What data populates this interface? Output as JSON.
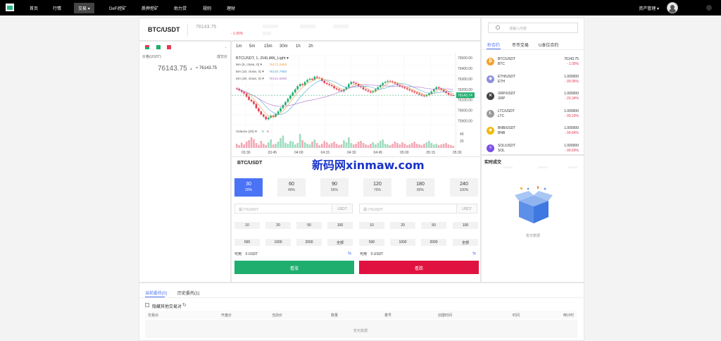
{
  "nav": {
    "items": [
      "首页",
      "行情",
      "交易",
      "DeFi挖矿",
      "质押挖矿",
      "助力贷",
      "规则",
      "理财"
    ],
    "active": "交易",
    "asset_menu": "资产管理"
  },
  "header": {
    "pair": "BTC/USDT",
    "price": "76143.75",
    "change": "- 1.00%"
  },
  "orderbook": {
    "col_price": "价格(USDT)",
    "col_volume": "成交价",
    "last_price": "76143.75",
    "last_sub": "76143.75"
  },
  "chart_toolbar": {
    "timeframes": [
      "1m",
      "5m",
      "15m",
      "30m",
      "1h",
      "2h"
    ]
  },
  "chart_data": {
    "type": "candlestick",
    "title": "BTCUSDT, 1, ZHILIAN_Light",
    "indicators": [
      {
        "name": "MA (5, close, 0)",
        "value": "76171.2900",
        "color": "#e8a23c"
      },
      {
        "name": "MA (10, close, 0)",
        "value": "76140.7950",
        "color": "#4aa3d8"
      },
      {
        "name": "MA (30, close, 0)",
        "value": "76161.5690",
        "color": "#b071c7"
      }
    ],
    "y_ticks": [
      "76500.00",
      "76400.00",
      "76300.00",
      "76200.00",
      "76143.74",
      "76100.00",
      "76000.00",
      "75900.00"
    ],
    "y_range": [
      75850,
      76520
    ],
    "current_price": 76143.74,
    "x_ticks": [
      "03:30",
      "03:45",
      "04:00",
      "04:15",
      "04:30",
      "04:45",
      "05:00",
      "05:15",
      "05:30"
    ],
    "volume_label": "Volume (20)",
    "volume_a": "0",
    "volume_b": "6",
    "volume_ticks": [
      "40",
      "20"
    ],
    "closes": [
      76205,
      76190,
      76175,
      76160,
      76130,
      76100,
      76085,
      76060,
      76020,
      75990,
      75960,
      75940,
      75915,
      75930,
      75950,
      75940,
      75965,
      75990,
      76020,
      76050,
      76080,
      76110,
      76140,
      76170,
      76200,
      76230,
      76250,
      76240,
      76270,
      76290,
      76300,
      76290,
      76320,
      76310,
      76305,
      76280,
      76260,
      76250,
      76240,
      76230,
      76210,
      76200,
      76190,
      76180,
      76200,
      76220,
      76250,
      76270,
      76260,
      76250,
      76230,
      76220,
      76200,
      76190,
      76180,
      76170,
      76180,
      76200,
      76220,
      76240,
      76260,
      76270,
      76280,
      76275,
      76265,
      76255,
      76240,
      76230,
      76220,
      76210,
      76200,
      76190,
      76180,
      76170,
      76160,
      76150,
      76140,
      76135,
      76145,
      76160,
      76180,
      76200,
      76220,
      76210,
      76195,
      76180,
      76165,
      76150,
      76145,
      76143
    ],
    "volumes": [
      12,
      8,
      15,
      10,
      18,
      22,
      30,
      25,
      14,
      9,
      20,
      12,
      8,
      16,
      24,
      10,
      12,
      18,
      28,
      35,
      15,
      12,
      20,
      18,
      10,
      14,
      40,
      22,
      16,
      12,
      10,
      18,
      24,
      14,
      8,
      12,
      20,
      16,
      10,
      14,
      18,
      12,
      8,
      10,
      22,
      16,
      30,
      14,
      10,
      12,
      18,
      20,
      14,
      10,
      8,
      12,
      16,
      10,
      14,
      20,
      24,
      12,
      10,
      8,
      12,
      18,
      14,
      10,
      16,
      12,
      8,
      10,
      14,
      18,
      12,
      10,
      8,
      12,
      16,
      20,
      14,
      10,
      12,
      8,
      10,
      12,
      14,
      10,
      8,
      6
    ]
  },
  "trade": {
    "title": "BTC/USDT",
    "periods": [
      {
        "sec": "30",
        "pct": "20%"
      },
      {
        "sec": "60",
        "pct": "40%"
      },
      {
        "sec": "90",
        "pct": "55%"
      },
      {
        "sec": "120",
        "pct": "70%"
      },
      {
        "sec": "180",
        "pct": "80%"
      },
      {
        "sec": "240",
        "pct": "100%"
      }
    ],
    "amount_placeholder": "最少%USDT",
    "unit": "USDT",
    "quick_left": [
      "10",
      "20",
      "50",
      "100",
      "500",
      "1000",
      "2000",
      "全部"
    ],
    "quick_right": [
      "10",
      "20",
      "50",
      "100",
      "500",
      "1000",
      "2000",
      "全部"
    ],
    "avail_label": "可用",
    "avail_value": "0 USDT",
    "buy_label": "看涨",
    "sell_label": "看跌",
    "buy_color": "#1fae6e",
    "sell_color": "#e0123f"
  },
  "markets": {
    "search_placeholder": "请输入内容",
    "tabs": [
      "秒合约",
      "币币交易",
      "U本位合约"
    ],
    "rows": [
      {
        "pair": "BTC/USDT",
        "sym": "BTC",
        "price": "76143.75",
        "change": "- 1.00%",
        "color": "#f2a22c",
        "glyph": "₿"
      },
      {
        "pair": "ETH/USDT",
        "sym": "ETH",
        "price": "1.000000",
        "change": "- 99.95%",
        "color": "#8c8fe0",
        "glyph": "◆"
      },
      {
        "pair": "XRP/USDT",
        "sym": "XRP",
        "price": "1.000000",
        "change": "- 20.34%",
        "color": "#444444",
        "glyph": "✕"
      },
      {
        "pair": "LTC/USDT",
        "sym": "LTC",
        "price": "1.000000",
        "change": "- 99.29%",
        "color": "#9a9a9a",
        "glyph": "Ł"
      },
      {
        "pair": "BNB/USDT",
        "sym": "BNB",
        "price": "1.000000",
        "change": "- 99.84%",
        "color": "#f0b90b",
        "glyph": "◈"
      },
      {
        "pair": "SOL/USDT",
        "sym": "SOL",
        "price": "1.000000",
        "change": "- 99.69%",
        "color": "#7b4fe6",
        "glyph": "≡"
      }
    ]
  },
  "realtime": {
    "title": "实时成交",
    "empty": "暂无数据"
  },
  "orders": {
    "tabs": [
      "当前委托(0)",
      "历史委托(1)"
    ],
    "hide_label": "隐藏其他交易对",
    "columns": [
      "交易对",
      "开盘价",
      "当前价",
      "数量",
      "量号",
      "创建时间",
      "时间",
      "倒计时"
    ],
    "empty": "暂无数据"
  },
  "watermark": "新码网xinmaw.com"
}
